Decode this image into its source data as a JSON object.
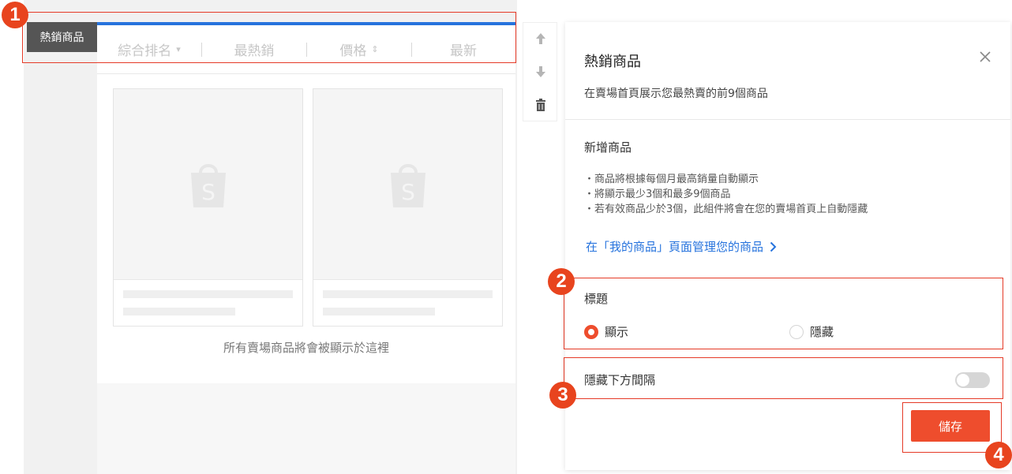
{
  "preview": {
    "tag_label": "熱銷商品",
    "sort_tabs": [
      {
        "label": "綜合排名",
        "suffix": "▾"
      },
      {
        "label": "最熱銷",
        "suffix": ""
      },
      {
        "label": "價格",
        "suffix": "⇕"
      },
      {
        "label": "最新",
        "suffix": ""
      }
    ],
    "empty_text": "所有賣場商品將會被顯示於這裡"
  },
  "toolbar": {
    "move_up_icon": "arrow-up-icon",
    "move_down_icon": "arrow-down-icon",
    "delete_icon": "trash-icon"
  },
  "panel": {
    "title": "熱銷商品",
    "subtitle": "在賣場首頁展示您最熱賣的前9個商品",
    "section_title": "新增商品",
    "bullets": [
      "・商品將根據每個月最高銷量自動顯示",
      "・將顯示最少3個和最多9個商品",
      "・若有效商品少於3個，此組件將會在您的賣場首頁上自動隱藏"
    ],
    "manage_link": "在「我的商品」頁面管理您的商品",
    "title_field": {
      "label": "標題",
      "options": [
        "顯示",
        "隱藏"
      ],
      "selected": "顯示"
    },
    "gap_field": {
      "label": "隱藏下方間隔",
      "enabled": false
    },
    "save_label": "儲存"
  },
  "steps": [
    "1",
    "2",
    "3",
    "4"
  ],
  "colors": {
    "accent": "#ee4d2d",
    "highlight": "#e53a27",
    "link": "#2673dd",
    "badge": "#e8441e"
  }
}
